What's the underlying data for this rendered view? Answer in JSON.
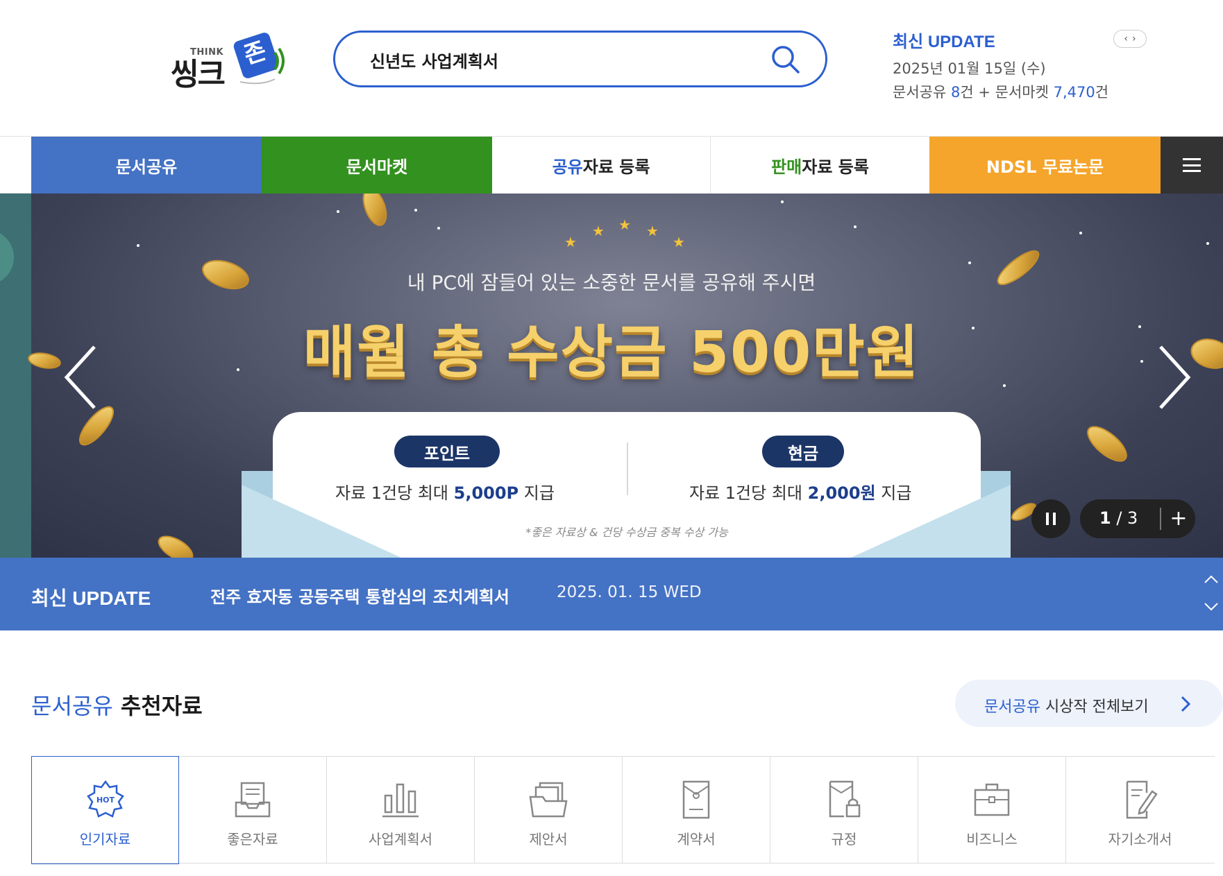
{
  "logo": {
    "think": "THINK",
    "main": "씽크",
    "badge": "존"
  },
  "search": {
    "value": "신년도 사업계획서",
    "button_icon": "search-icon"
  },
  "latest_update": {
    "title": "최신 UPDATE",
    "date": "2025년 01월 15일 (수)",
    "share_label": "문서공유",
    "share_count": "8",
    "share_unit": "건 + ",
    "market_label": "문서마켓",
    "market_count": "7,470",
    "market_unit": "건"
  },
  "nav": {
    "doc_share": "문서공유",
    "doc_market": "문서마켓",
    "share_register_hl": "공유",
    "share_register_rest": "자료 등록",
    "sell_register_hl": "판매",
    "sell_register_rest": "자료 등록",
    "ndsl": "NDSL 무료논문",
    "menu_icon": "hamburger-icon"
  },
  "banner": {
    "subtitle": "내 PC에 잠들어 있는 소중한 문서를 공유해 주시면",
    "title": "매월 총 수상금 500만원",
    "point_pill": "포인트",
    "point_text_pre": "자료 1건당 최대 ",
    "point_text_value": "5,000P",
    "point_text_post": " 지급",
    "cash_pill": "현금",
    "cash_text_pre": "자료 1건당 최대 ",
    "cash_text_value": "2,000원",
    "cash_text_post": " 지급",
    "note": "*좋은 자료상 & 건당 수상금 중복 수상 가능",
    "pager_current": "1",
    "pager_sep": " / ",
    "pager_total": "3",
    "pager_plus": "+"
  },
  "ticker": {
    "label": "최신 UPDATE",
    "title": "전주 효자동 공동주택 통합심의 조치계획서",
    "date": "2025. 01. 15 WED"
  },
  "recommend": {
    "title_blue": "문서공유",
    "title_rest": " 추천자료",
    "view_all_blue": "문서공유",
    "view_all_rest": " 시상작 전체보기",
    "categories": [
      {
        "label": "인기자료",
        "icon": "hot-badge-icon"
      },
      {
        "label": "좋은자료",
        "icon": "document-tray-icon"
      },
      {
        "label": "사업계획서",
        "icon": "bar-chart-icon"
      },
      {
        "label": "제안서",
        "icon": "folder-documents-icon"
      },
      {
        "label": "계약서",
        "icon": "sealed-envelope-icon"
      },
      {
        "label": "규정",
        "icon": "document-lock-icon"
      },
      {
        "label": "비즈니스",
        "icon": "briefcase-icon"
      },
      {
        "label": "자기소개서",
        "icon": "document-pen-icon"
      }
    ]
  },
  "colors": {
    "primary_blue": "#4472c4",
    "market_green": "#33911f",
    "ndsl_orange": "#f5a52b",
    "menu_dark": "#333333",
    "accent_blue": "#2b5fcf"
  }
}
